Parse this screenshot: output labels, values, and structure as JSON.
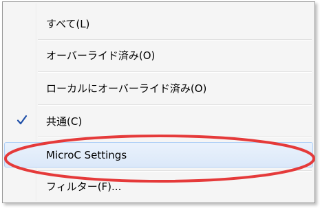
{
  "menu": {
    "items": [
      {
        "label": "すべて(L)",
        "checked": false
      },
      {
        "label": "オーバーライド済み(O)",
        "checked": false
      },
      {
        "label": "ローカルにオーバーライド済み(O)",
        "checked": false
      },
      {
        "label": "共通(C)",
        "checked": true
      },
      {
        "label": "MicroC Settings",
        "checked": false,
        "highlighted": true
      },
      {
        "label": "フィルター(F)...",
        "checked": false
      }
    ]
  },
  "colors": {
    "annotation_ellipse": "#e53a3a",
    "check_mark": "#1f4fa8",
    "highlight_border": "#aecff7"
  },
  "icons": {
    "check": "check-icon"
  }
}
